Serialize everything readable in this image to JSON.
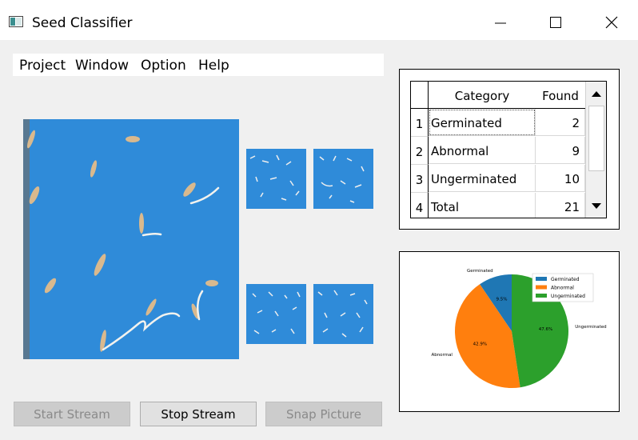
{
  "window": {
    "title": "Seed Classifier",
    "controls": [
      "minimize",
      "maximize",
      "close"
    ]
  },
  "menu": [
    "Project",
    "Window",
    "Option",
    "Help"
  ],
  "table": {
    "headers": [
      "Category",
      "Found"
    ],
    "rows": [
      {
        "index": "1",
        "category": "Germinated",
        "found": "2"
      },
      {
        "index": "2",
        "category": "Abnormal",
        "found": "9"
      },
      {
        "index": "3",
        "category": "Ungerminated",
        "found": "10"
      },
      {
        "index": "4",
        "category": "Total",
        "found": "21"
      }
    ]
  },
  "buttons": {
    "start": "Start Stream",
    "stop": "Stop Stream",
    "snap": "Snap Picture"
  },
  "chart_data": {
    "type": "pie",
    "labels": [
      "Germinated",
      "Abnormal",
      "Ungerminated"
    ],
    "values": [
      9.5,
      42.9,
      47.6
    ],
    "percent_labels": [
      "9.5%",
      "42.9%",
      "47.6%"
    ],
    "colors": [
      "#1f77b4",
      "#ff7f0e",
      "#2ca02c"
    ],
    "legend": [
      "Germinated",
      "Abnormal",
      "Ungerminated"
    ],
    "legend_position": "top-right"
  }
}
